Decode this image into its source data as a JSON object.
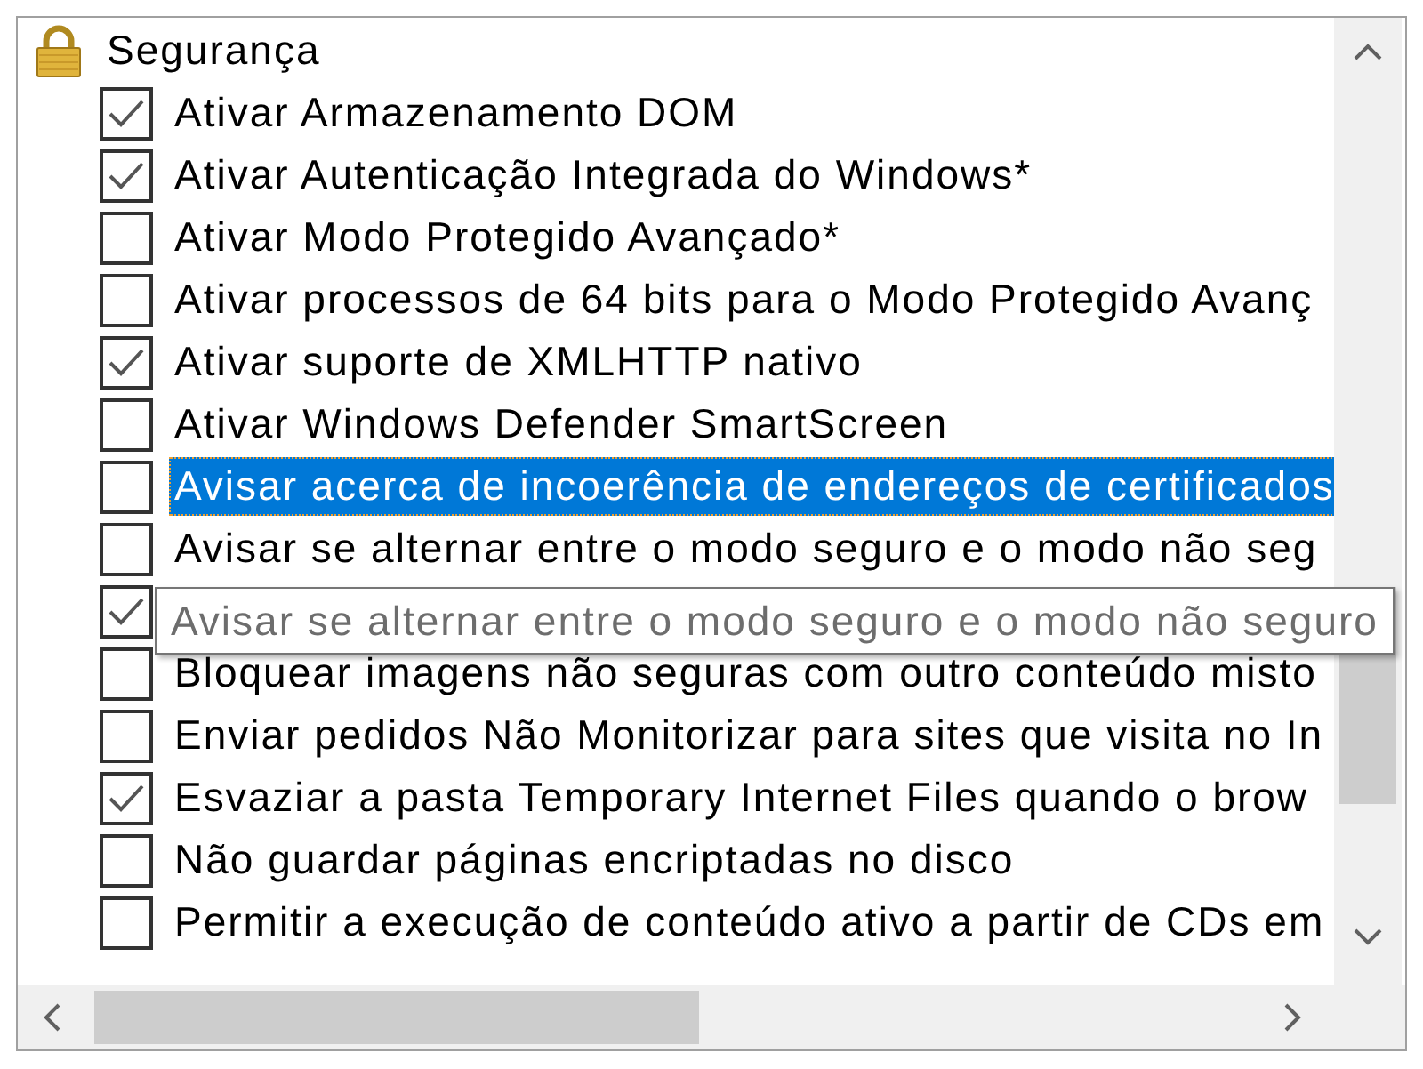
{
  "group": {
    "title": "Segurança"
  },
  "items": [
    {
      "label": "Ativar Armazenamento DOM",
      "checked": true,
      "selected": false
    },
    {
      "label": "Ativar Autenticação Integrada do Windows*",
      "checked": true,
      "selected": false
    },
    {
      "label": "Ativar Modo Protegido Avançado*",
      "checked": false,
      "selected": false
    },
    {
      "label": "Ativar processos de 64 bits para o Modo Protegido Avanç",
      "checked": false,
      "selected": false
    },
    {
      "label": "Ativar suporte de XMLHTTP nativo",
      "checked": true,
      "selected": false
    },
    {
      "label": "Ativar Windows Defender SmartScreen",
      "checked": false,
      "selected": false
    },
    {
      "label": "Avisar acerca de incoerência de endereços de certificados",
      "checked": false,
      "selected": true
    },
    {
      "label": "Avisar se alternar entre o modo seguro e o modo não seg",
      "checked": false,
      "selected": false
    },
    {
      "checked": true,
      "selected": false
    },
    {
      "label": "Bloquear imagens não seguras com outro conteúdo misto",
      "checked": false,
      "selected": false
    },
    {
      "label": "Enviar pedidos Não Monitorizar para sites que visita no In",
      "checked": false,
      "selected": false
    },
    {
      "label": "Esvaziar a pasta Temporary Internet Files quando o brow",
      "checked": true,
      "selected": false
    },
    {
      "label": "Não guardar páginas encriptadas no disco",
      "checked": false,
      "selected": false
    },
    {
      "label": "Permitir a execução de conteúdo ativo a partir de CDs em",
      "checked": false,
      "selected": false
    }
  ],
  "tooltip": {
    "text": "Avisar se alternar entre o modo seguro e o modo não seguro"
  }
}
